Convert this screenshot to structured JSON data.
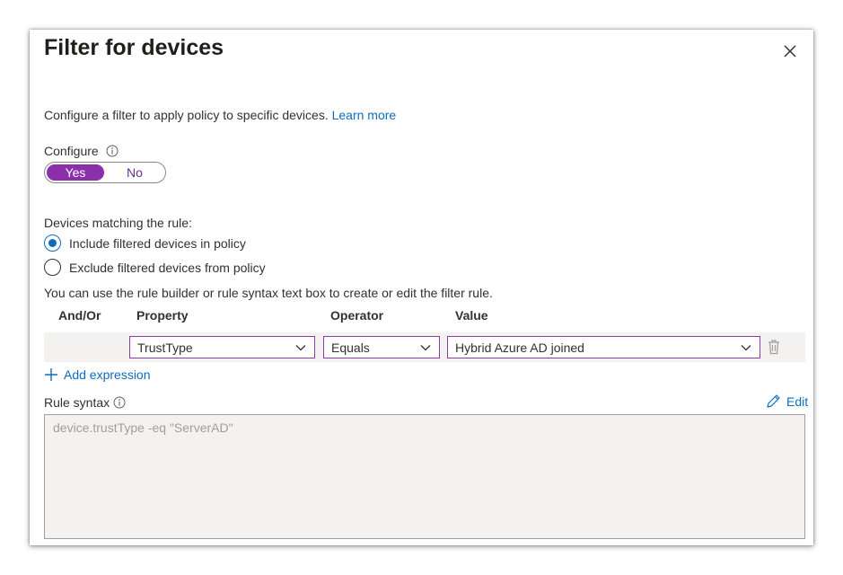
{
  "dialog": {
    "title": "Filter for devices",
    "description": "Configure a filter to apply policy to specific devices.",
    "learn_more": "Learn more"
  },
  "configure": {
    "label": "Configure",
    "options": [
      "Yes",
      "No"
    ],
    "selected": "Yes"
  },
  "matching": {
    "label": "Devices matching the rule:",
    "options": [
      {
        "label": "Include filtered devices in policy",
        "checked": true
      },
      {
        "label": "Exclude filtered devices from policy",
        "checked": false
      }
    ]
  },
  "builder": {
    "hint": "You can use the rule builder or rule syntax text box to create or edit the filter rule.",
    "columns": {
      "andor": "And/Or",
      "property": "Property",
      "operator": "Operator",
      "value": "Value"
    },
    "row": {
      "property": "TrustType",
      "operator": "Equals",
      "value": "Hybrid Azure AD joined"
    },
    "add_expression": "Add expression"
  },
  "rule_syntax": {
    "label": "Rule syntax",
    "edit": "Edit",
    "placeholder": "device.trustType -eq \"ServerAD\""
  },
  "colors": {
    "accent_purple": "#8b2fab",
    "link_blue": "#0f6cbd"
  },
  "icons": [
    "close-icon",
    "info-icon",
    "chevron-down-icon",
    "trash-icon",
    "plus-icon",
    "pencil-icon"
  ]
}
